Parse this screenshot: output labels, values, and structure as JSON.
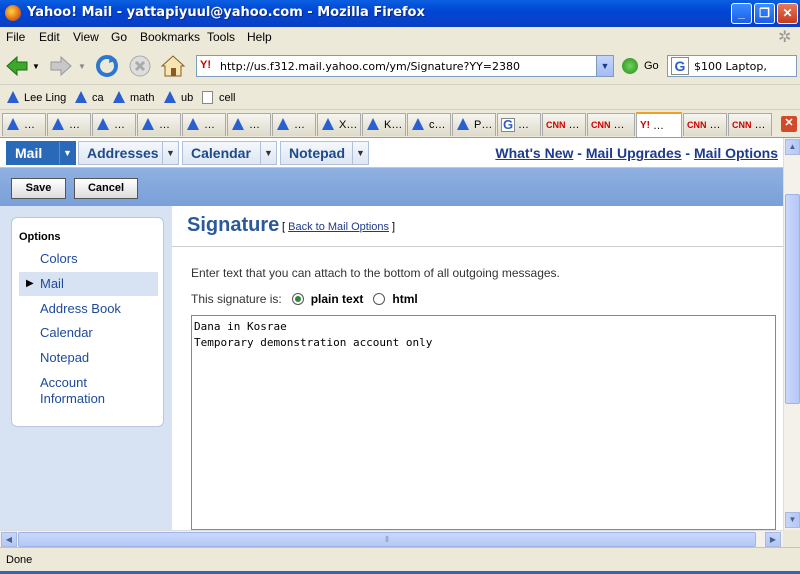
{
  "window": {
    "title": "Yahoo! Mail - yattapiyuul@yahoo.com - Mozilla Firefox"
  },
  "menu": [
    "File",
    "Edit",
    "View",
    "Go",
    "Bookmarks",
    "Tools",
    "Help"
  ],
  "nav": {
    "url": "http://us.f312.mail.yahoo.com/ym/Signature?YY=2380",
    "go_label": "Go",
    "search_text": "$100 Laptop,"
  },
  "bookmarks": [
    "Lee Ling",
    "ca",
    "math",
    "ub",
    "cell"
  ],
  "tabs": [
    "…",
    "…",
    "…",
    "…",
    "…",
    "…",
    "…",
    "…",
    "X…",
    "K…",
    "c…",
    "P…",
    "…",
    "…",
    "…",
    "…",
    "…",
    "…"
  ],
  "ym": {
    "tabs": [
      "Mail",
      "Addresses",
      "Calendar",
      "Notepad"
    ],
    "links": {
      "whats_new": "What's New",
      "sep": " - ",
      "upgrades": "Mail Upgrades",
      "options": "Mail Options"
    },
    "buttons": {
      "save": "Save",
      "cancel": "Cancel"
    },
    "options": {
      "header": "Options",
      "items": [
        "Colors",
        "Mail",
        "Address Book",
        "Calendar",
        "Notepad",
        "Account",
        "Information"
      ]
    },
    "signature": {
      "title": "Signature",
      "back_open": "[ ",
      "back_link": "Back to Mail Options",
      "back_close": " ]",
      "description": "Enter text that you can attach to the bottom of all outgoing messages.",
      "is_label": "This signature is:",
      "plain_label": "plain text",
      "html_label": "html",
      "text": "Dana in Kosrae\nTemporary demonstration account only"
    }
  },
  "status": {
    "text": "Done"
  }
}
